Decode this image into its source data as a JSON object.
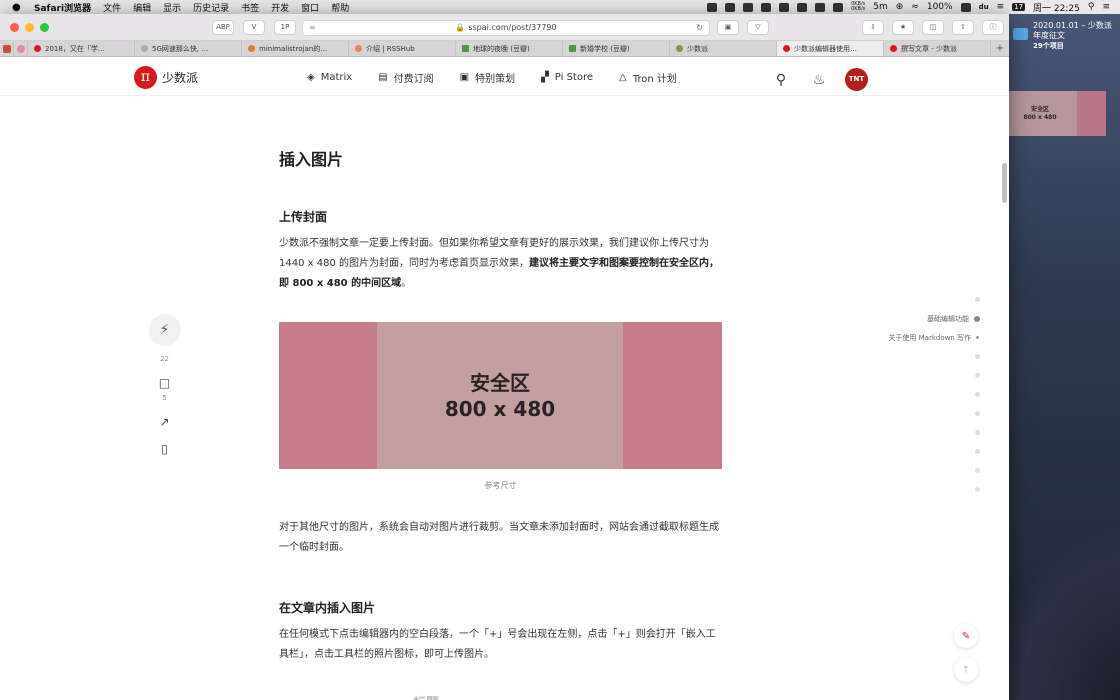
{
  "menubar": {
    "apple": "",
    "app": "Safari浏览器",
    "items": [
      "文件",
      "编辑",
      "显示",
      "历史记录",
      "书签",
      "开发",
      "窗口",
      "帮助"
    ],
    "net_up": "0KB/s",
    "net_down": "0KB/s",
    "duration": "5m",
    "battery": "100%",
    "date_num": "17",
    "clock": "周一 22:25"
  },
  "browser": {
    "url": "sspai.com/post/37790",
    "toolbar": {
      "btn1": "ABP",
      "btn2": "V",
      "btn3": "1P",
      "btn4": "≡"
    },
    "tabs": [
      {
        "label": "2018，又在「学…",
        "color": "#d71a1b"
      },
      {
        "label": "5G网速那么快, …",
        "color": "#aaa"
      },
      {
        "label": "minimalistrojan的…",
        "color": "#e0812c"
      },
      {
        "label": "介绍 | RSSHub",
        "color": "#f08050"
      },
      {
        "label": "地球的夜晚 (豆瓣)",
        "color": "#4b9a3c"
      },
      {
        "label": "新婚学校 (豆瓣)",
        "color": "#4b9a3c"
      },
      {
        "label": "少数派",
        "color": "#7a9a3c"
      },
      {
        "label": "少数派编辑器使用…",
        "color": "#d71a1b"
      },
      {
        "label": "撰写文章 - 少数派",
        "color": "#d71a1b"
      }
    ],
    "active_tab_index": 7
  },
  "site": {
    "logo_text": "少数派",
    "logo_symbol": "π",
    "nav": [
      {
        "label": "Matrix",
        "icon": "cube-icon"
      },
      {
        "label": "付费订阅",
        "icon": "book-icon"
      },
      {
        "label": "特别策划",
        "icon": "briefcase-icon"
      },
      {
        "label": "Pi Store",
        "icon": "store-icon"
      },
      {
        "label": "Tron 计划",
        "icon": "flask-icon"
      }
    ],
    "avatar_initials": "TNT"
  },
  "article": {
    "h2": "插入图片",
    "sec1_title": "上传封面",
    "sec1_para_a": "少数派不强制文章一定要上传封面。但如果你希望文章有更好的展示效果，我们建议你上传尺寸为 1440 x 480 的图片为封面，同时为考虑首页显示效果，",
    "sec1_para_b": "建议将主要文字和图案要控制在安全区内，即 800 x 480 的中间区域",
    "sec1_para_c": "。",
    "figure_title": "安全区",
    "figure_size": "800 x 480",
    "figure_caption": "参考尺寸",
    "sec1_para2": "对于其他尺寸的图片，系统会自动对图片进行裁剪。当文章未添加封面时，网站会通过截取标题生成一个临时封面。",
    "sec2_title": "在文章内插入图片",
    "sec2_para": "在任何模式下点击编辑器内的空白段落，一个「+」号会出现在左侧，点击「+」则会打开「嵌入工具栏」，点击工具栏的照片图标，即可上传图片。",
    "ghost_heading": "标题"
  },
  "actions": {
    "charge_count": "22",
    "comment_count": "5"
  },
  "toc": [
    {
      "label": "",
      "state": "dot"
    },
    {
      "label": "基础编辑功能",
      "state": "active"
    },
    {
      "label": "关于使用 Markdown 写作",
      "state": "mid"
    },
    {
      "label": "",
      "state": "dot"
    },
    {
      "label": "",
      "state": "dot"
    },
    {
      "label": "",
      "state": "dot"
    },
    {
      "label": "",
      "state": "dot"
    },
    {
      "label": "",
      "state": "dot"
    },
    {
      "label": "",
      "state": "dot"
    },
    {
      "label": "",
      "state": "dot"
    },
    {
      "label": "",
      "state": "dot"
    }
  ],
  "desktop": {
    "folder_name": "2020.01.01 – 少数派年度征文",
    "folder_count": "29个项目",
    "drag_title": "安全区",
    "drag_size": "800 x 480"
  },
  "colors": {
    "brand": "#d71a1b",
    "figure_side": "#c77c8a",
    "figure_safe": "#c39fa0"
  }
}
